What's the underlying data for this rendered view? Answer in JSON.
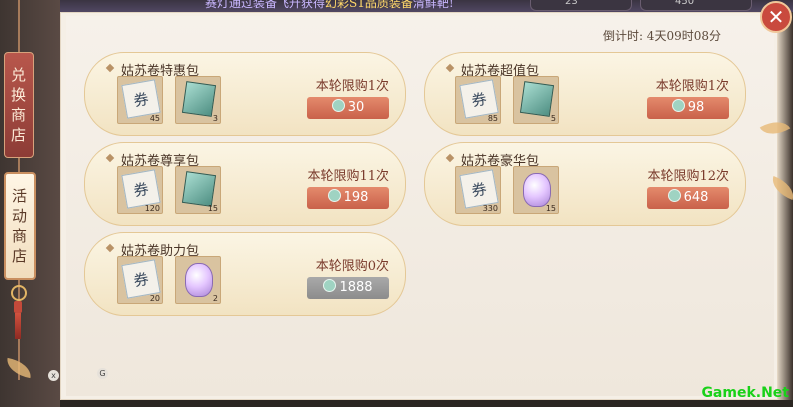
{
  "banner": {
    "text_a": "赛灯通过装备飞升获得",
    "text_b": "幻彩S1品质装备",
    "text_c": "清鲜靶!",
    "res_values": [
      "23",
      "450"
    ]
  },
  "sidebar": {
    "tabs": [
      {
        "label": [
          "兑",
          "换",
          "商",
          "店"
        ]
      },
      {
        "label": [
          "活",
          "动",
          "商",
          "店"
        ]
      }
    ]
  },
  "shop": {
    "countdown": "倒计时: 4天09时08分",
    "close": "✕",
    "packs": [
      {
        "title": "姑苏卷特惠包",
        "limit": "本轮限购1次",
        "price": "30",
        "items": [
          {
            "icon": "scroll-icon",
            "qty": "45"
          },
          {
            "icon": "notes-icon",
            "qty": "3"
          }
        ]
      },
      {
        "title": "姑苏卷超值包",
        "limit": "本轮限购1次",
        "price": "98",
        "items": [
          {
            "icon": "scroll-icon",
            "qty": "85"
          },
          {
            "icon": "notes-icon",
            "qty": "5"
          }
        ]
      },
      {
        "title": "姑苏卷尊享包",
        "limit": "本轮限购11次",
        "price": "198",
        "items": [
          {
            "icon": "scroll-icon",
            "qty": "120"
          },
          {
            "icon": "notes-icon",
            "qty": "15"
          }
        ]
      },
      {
        "title": "姑苏卷豪华包",
        "limit": "本轮限购12次",
        "price": "648",
        "items": [
          {
            "icon": "scroll-icon",
            "qty": "330"
          },
          {
            "icon": "crystal-icon",
            "qty": "15"
          }
        ]
      },
      {
        "title": "姑苏卷助力包",
        "limit": "本轮限购0次",
        "price": "1888",
        "items": [
          {
            "icon": "scroll-icon",
            "qty": "20"
          },
          {
            "icon": "crystal-icon",
            "qty": "2"
          }
        ]
      }
    ],
    "scroll_glyph": "券"
  },
  "watermark": "Gamek.Net",
  "hints": [
    "x",
    "G"
  ],
  "colors": {
    "accent": "#c9614a",
    "disabled": "#8c8c8c",
    "coin": "#9fd3c2"
  }
}
